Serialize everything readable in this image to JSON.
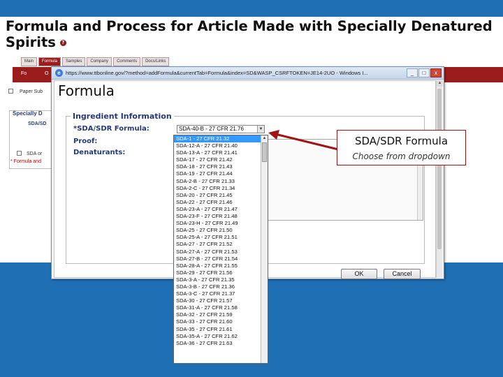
{
  "slide": {
    "title": "Formula and Process for Article Made with Specially Denatured Spirits",
    "help_icon_glyph": "?"
  },
  "background_app": {
    "tabs": [
      "Main",
      "Formula",
      "Samples",
      "Company",
      "Comments",
      "Docs/Links"
    ],
    "active_tab": "Formula",
    "redbar_items": [
      "Fo",
      "O"
    ],
    "paper_label": "Paper Sub",
    "section_title": "Specially D",
    "section_sub": "SDA/SD",
    "sda_option": "SDA or",
    "formula_required": "* Formula and"
  },
  "popup": {
    "url": "https://www.ttbonline.gov/?method=addFormula&currentTab=Formula&index=SD&WASP_CSRFTOKEN=JE14-2UO - Windows I...",
    "window_buttons": [
      "_",
      "□",
      "x"
    ],
    "heading": "Formula",
    "ingredient_section": "Ingredient Information",
    "labels": {
      "sda_formula": "*SDA/SDR Formula:",
      "proof": "Proof:",
      "denaturants": "Denaturants:"
    },
    "select_value": "SDA-40-B - 27 CFR 21.76",
    "ok_label": "OK",
    "cancel_label": "Cancel"
  },
  "dropdown": {
    "options": [
      "SDA-1 - 27 CFR 21.32",
      "SDA-12-A - 27 CFR 21.40",
      "SDA-13-A - 27 CFR 21.41",
      "SDA-17 - 27 CFR 21.42",
      "SDA-18 - 27 CFR 21.43",
      "SDA-19 - 27 CFR 21.44",
      "SDA-2-B - 27 CFR 21.33",
      "SDA-2-C - 27 CFR 21.34",
      "SDA-20 - 27 CFR 21.45",
      "SDA-22 - 27 CFR 21.46",
      "SDA-23-A - 27 CFR 21.47",
      "SDA-23-F - 27 CFR 21.48",
      "SDA-23-H - 27 CFR 21.49",
      "SDA-25 - 27 CFR 21.50",
      "SDA-25-A - 27 CFR 21.51",
      "SDA-27 - 27 CFR 21.52",
      "SDA-27-A - 27 CFR 21.53",
      "SDA-27-B - 27 CFR 21.54",
      "SDA-28-A - 27 CFR 21.55",
      "SDA-29 - 27 CFR 21.56",
      "SDA-3-A - 27 CFR 21.35",
      "SDA-3-B - 27 CFR 21.36",
      "SDA-3-C - 27 CFR 21.37",
      "SDA-30 - 27 CFR 21.57",
      "SDA-31-A - 27 CFR 21.58",
      "SDA-32 - 27 CFR 21.59",
      "SDA-33 - 27 CFR 21.60",
      "SDA-35 - 27 CFR 21.61",
      "SDA-35-A - 27 CFR 21.62",
      "SDA-36 - 27 CFR 21.63"
    ],
    "selected_index": 0
  },
  "callout": {
    "title": "SDA/SDR Formula",
    "subtitle": "Choose from dropdown"
  },
  "colors": {
    "slide_blue": "#1f6fb5",
    "app_red": "#9b1c1c",
    "label_navy": "#243a78",
    "selection_blue": "#3399ff",
    "callout_border": "#a01414"
  }
}
